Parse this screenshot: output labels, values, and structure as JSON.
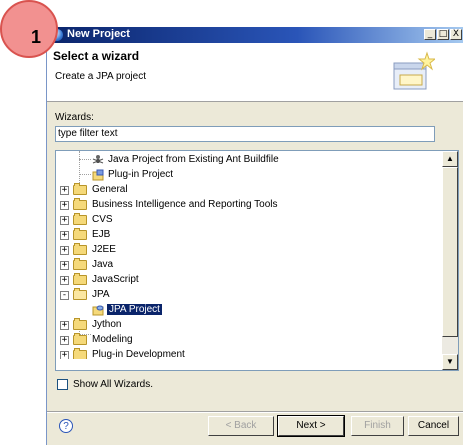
{
  "step_badge": "1",
  "window": {
    "title": "New Project",
    "controls": {
      "minimize": "_",
      "maximize": "□",
      "close": "X"
    }
  },
  "banner": {
    "title": "Select a wizard",
    "subtitle": "Create a JPA project"
  },
  "filter": {
    "label": "Wizards:",
    "value": "type filter text"
  },
  "tree": {
    "items": [
      {
        "label": "Java Project from Existing Ant Buildfile",
        "icon": "ant-buildfile-icon"
      },
      {
        "label": "Plug-in Project",
        "icon": "plugin-project-icon"
      },
      {
        "label": "General",
        "icon": "folder-icon",
        "expander": "+"
      },
      {
        "label": "Business Intelligence and Reporting Tools",
        "icon": "folder-icon",
        "expander": "+"
      },
      {
        "label": "CVS",
        "icon": "folder-icon",
        "expander": "+"
      },
      {
        "label": "EJB",
        "icon": "folder-icon",
        "expander": "+"
      },
      {
        "label": "J2EE",
        "icon": "folder-icon",
        "expander": "+"
      },
      {
        "label": "Java",
        "icon": "folder-icon",
        "expander": "+"
      },
      {
        "label": "JavaScript",
        "icon": "folder-icon",
        "expander": "+"
      },
      {
        "label": "JPA",
        "icon": "folder-open-icon",
        "expander": "-"
      },
      {
        "label": "JPA Project",
        "icon": "jpa-project-icon",
        "selected": true
      },
      {
        "label": "Jython",
        "icon": "folder-icon",
        "expander": "+"
      },
      {
        "label": "Modeling",
        "icon": "folder-icon",
        "expander": "+"
      },
      {
        "label": "Plug-in Development",
        "icon": "folder-icon",
        "expander": "+"
      }
    ]
  },
  "show_all_wizards": {
    "label": "Show All Wizards.",
    "checked": false
  },
  "buttons": {
    "help": "?",
    "back": "< Back",
    "next": "Next >",
    "finish": "Finish",
    "cancel": "Cancel"
  },
  "scrollbar": {
    "up": "▲",
    "down": "▼"
  },
  "colors": {
    "title_bar": "#0a246a",
    "selection": "#0a246a",
    "badge": "#f29190"
  }
}
